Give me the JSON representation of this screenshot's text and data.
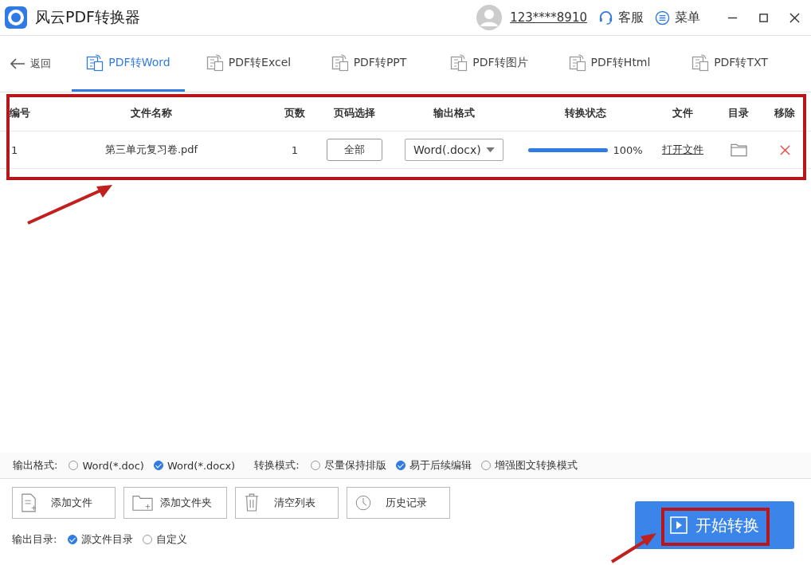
{
  "window": {
    "title": "风云PDF转换器",
    "user": "123****8910",
    "service": "客服",
    "menu": "菜单"
  },
  "nav": {
    "back": "返回",
    "tabs": [
      {
        "label": "PDF转Word",
        "selected": true
      },
      {
        "label": "PDF转Excel",
        "selected": false
      },
      {
        "label": "PDF转PPT",
        "selected": false
      },
      {
        "label": "PDF转图片",
        "selected": false
      },
      {
        "label": "PDF转Html",
        "selected": false
      },
      {
        "label": "PDF转TXT",
        "selected": false
      }
    ]
  },
  "table": {
    "columns": [
      "编号",
      "文件名称",
      "页数",
      "页码选择",
      "输出格式",
      "转换状态",
      "文件",
      "目录",
      "移除"
    ],
    "rows": [
      {
        "index": "1",
        "name": "第三单元复习卷.pdf",
        "pages": "1",
        "page_select": "全部",
        "format": "Word(.docx)",
        "level": 1,
        "progress": "100%",
        "open": "打开文件"
      }
    ]
  },
  "options": [
    {
      "label": "输出格式:",
      "choices": [
        {
          "label": "Word(*.doc)",
          "selected": false
        },
        {
          "label": "Word(*.docx)",
          "selected": true
        }
      ]
    },
    {
      "label": "转换模式:",
      "choices": [
        {
          "label": "尽量保持排版",
          "selected": false
        },
        {
          "label": "易于后续编辑",
          "selected": true
        },
        {
          "label": "增强图文转换模式",
          "selected": false
        }
      ]
    }
  ],
  "actions": [
    {
      "kind": "file",
      "label": "添加文件"
    },
    {
      "kind": "folder",
      "label": "添加文件夹"
    },
    {
      "kind": "trash",
      "label": "清空列表"
    },
    {
      "kind": "history",
      "label": "历史记录"
    }
  ],
  "output_dir": {
    "label": "输出目录:",
    "choices": [
      {
        "label": "源文件目录",
        "selected": true
      },
      {
        "label": "自定义",
        "selected": false
      }
    ]
  },
  "start": "开始转换"
}
